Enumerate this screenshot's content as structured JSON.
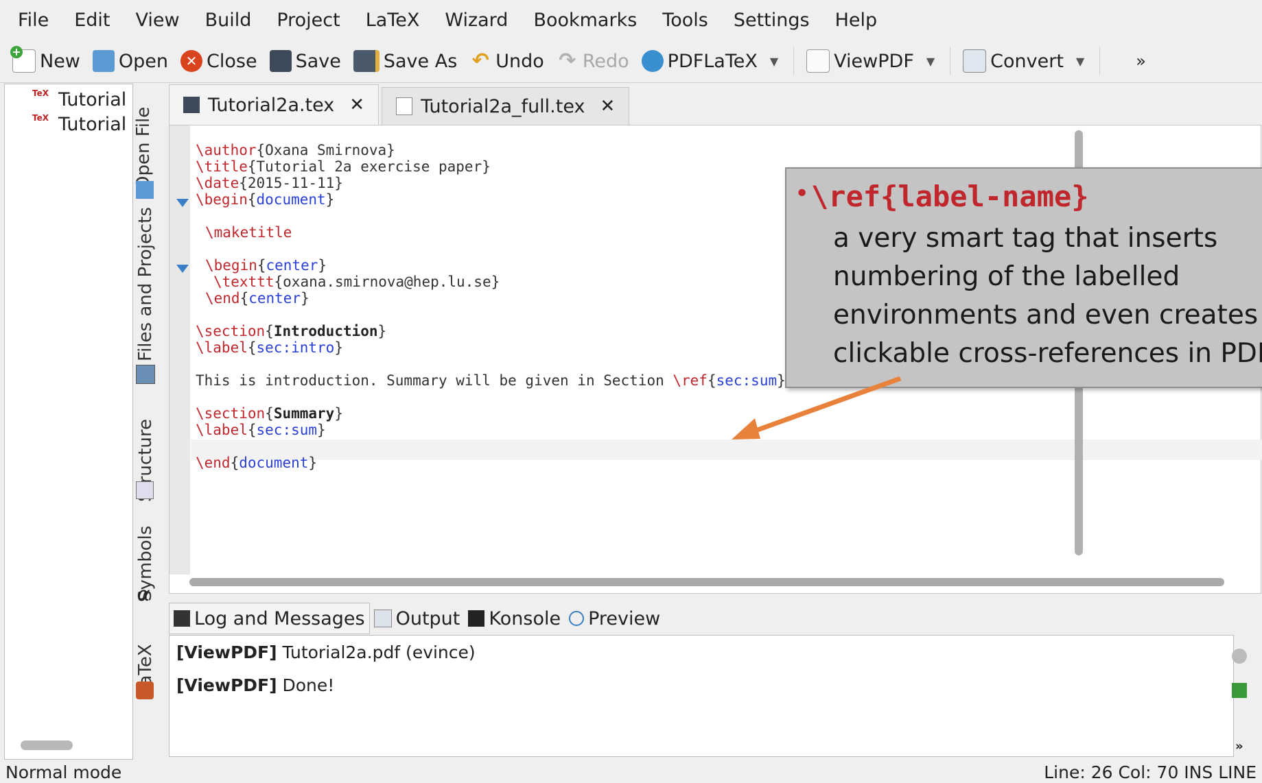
{
  "menu": [
    "File",
    "Edit",
    "View",
    "Build",
    "Project",
    "LaTeX",
    "Wizard",
    "Bookmarks",
    "Tools",
    "Settings",
    "Help"
  ],
  "toolbar": {
    "new": "New",
    "open": "Open",
    "close": "Close",
    "save": "Save",
    "save_as": "Save As",
    "undo": "Undo",
    "redo": "Redo",
    "pdflatex": "PDFLaTeX",
    "viewpdf": "ViewPDF",
    "convert": "Convert",
    "more": "»"
  },
  "tree": {
    "items": [
      "Tutorial",
      "Tutorial"
    ]
  },
  "side_tabs": {
    "open_file": "Open File",
    "files_projects": "Files and Projects",
    "structure": "Structure",
    "symbols": "Symbols",
    "latex": "LaTeX"
  },
  "tabs": [
    {
      "label": "Tutorial2a.tex",
      "close": "✕"
    },
    {
      "label": "Tutorial2a_full.tex",
      "close": "✕"
    }
  ],
  "code": {
    "l1_cmd": "\\author",
    "l1_arg": "{Oxana Smirnova}",
    "l2_cmd": "\\title",
    "l2_arg": "{Tutorial 2a exercise paper}",
    "l3_cmd": "\\date",
    "l3_arg": "{2015-11-11}",
    "l4_cmd": "\\begin",
    "l4_arg": "document",
    "l5_cmd": "\\maketitle",
    "l6_cmd": "\\begin",
    "l6_arg": "center",
    "l7_cmd": "\\texttt",
    "l7_arg": "{oxana.smirnova@hep.lu.se}",
    "l8_cmd": "\\end",
    "l8_arg": "center",
    "l9_cmd": "\\section",
    "l9_arg": "Introduction",
    "l10_cmd": "\\label",
    "l10_arg": "sec:intro",
    "l11_text": "This is introduction. Summary will be given in Section ",
    "l11_cmd": "\\ref",
    "l11_arg": "sec:sum",
    "l11_end": "}.",
    "l12_cmd": "\\section",
    "l12_arg": "Summary",
    "l13_cmd": "\\label",
    "l13_arg": "sec:sum",
    "l14_cmd": "\\end",
    "l14_arg": "document"
  },
  "callout": {
    "bullet": "•",
    "title": "\\ref{label-name}",
    "lines": [
      "a very smart tag that inserts",
      "numbering of the labelled",
      "environments and even creates",
      "clickable cross-references in PDF"
    ]
  },
  "log_tabs": [
    "Log and Messages",
    "Output",
    "Konsole",
    "Preview"
  ],
  "log": [
    {
      "tag": "[ViewPDF]",
      "text": " Tutorial2a.pdf (evince)"
    },
    {
      "tag": "[ViewPDF]",
      "text": " Done!"
    }
  ],
  "status": {
    "mode": "Normal mode",
    "position": "Line: 26 Col: 70  INS  LINE"
  },
  "colors": {
    "command": "#c0272d",
    "argument": "#2a3fd6",
    "arrow": "#e8823a"
  }
}
